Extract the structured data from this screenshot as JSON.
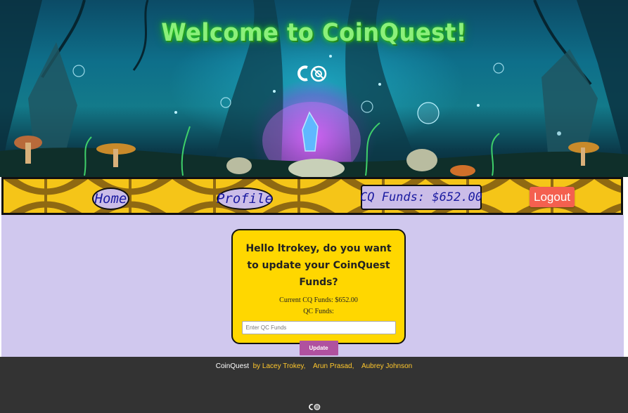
{
  "hero": {
    "title": "Welcome to CoinQuest!",
    "logo_icon": "coinquest-logo-icon",
    "background": "fantasy-forest-scene"
  },
  "nav": {
    "home_label": "Home",
    "profile_label": "Profile",
    "funds_display": "CQ Funds: $652.00",
    "logout_label": "Logout"
  },
  "update_card": {
    "heading": "Hello ltrokey, do you want to update your CoinQuest Funds?",
    "current_funds": "Current CQ Funds: $652.00",
    "input_label": "QC Funds:",
    "input_placeholder": "Enter QC Funds",
    "input_value": "",
    "submit_label": "Update"
  },
  "footer": {
    "brand": "CoinQuest",
    "by_label": "by",
    "authors": [
      "Lacey Trokey,",
      "Arun Prasad,",
      "Aubrey Johnson"
    ],
    "logo_icon": "coinquest-logo-icon"
  },
  "colors": {
    "title_green": "#8bf07a",
    "nav_yellow": "#f5c518",
    "pill_lavender": "#cbbde8",
    "logout_red": "#f4604f",
    "main_bg": "#d0c8ee",
    "card_yellow": "#ffd700",
    "update_purple": "#b0519f",
    "footer_bg": "#333333",
    "footer_text": "#ffc72c"
  }
}
